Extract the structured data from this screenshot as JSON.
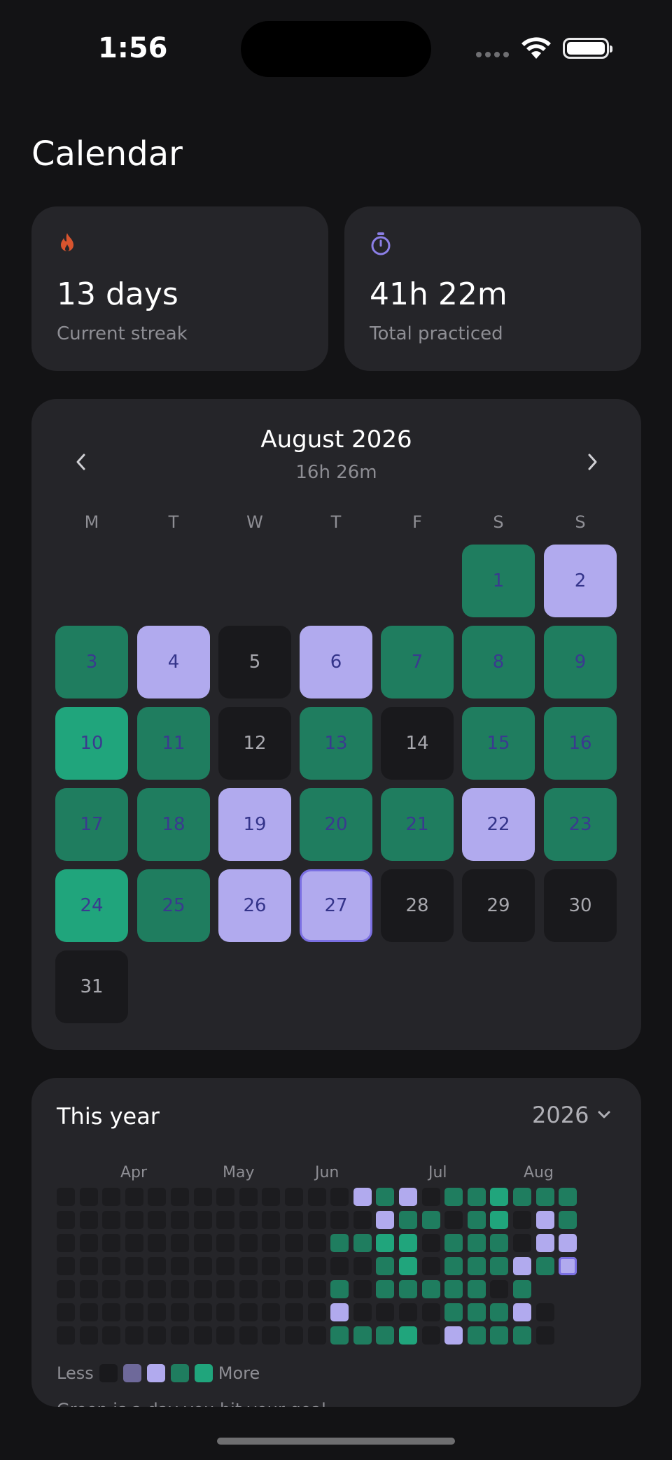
{
  "status": {
    "time": "1:56"
  },
  "page": {
    "title": "Calendar"
  },
  "stats": {
    "streak": {
      "value": "13 days",
      "label": "Current streak",
      "icon": "flame-icon",
      "color": "#d8542e"
    },
    "total": {
      "value": "41h 22m",
      "label": "Total practiced",
      "icon": "stopwatch-icon",
      "color": "#8b7fe6"
    }
  },
  "calendar": {
    "month": "August 2026",
    "total": "16h 26m",
    "weekdays": [
      "M",
      "T",
      "W",
      "T",
      "F",
      "S",
      "S"
    ],
    "days": [
      {
        "day": "1",
        "state": "green"
      },
      {
        "day": "2",
        "state": "purple"
      },
      {
        "day": "3",
        "state": "green"
      },
      {
        "day": "4",
        "state": "purple"
      },
      {
        "day": "5",
        "state": "empty"
      },
      {
        "day": "6",
        "state": "purple"
      },
      {
        "day": "7",
        "state": "green"
      },
      {
        "day": "8",
        "state": "green"
      },
      {
        "day": "9",
        "state": "green"
      },
      {
        "day": "10",
        "state": "bright"
      },
      {
        "day": "11",
        "state": "green"
      },
      {
        "day": "12",
        "state": "empty"
      },
      {
        "day": "13",
        "state": "green"
      },
      {
        "day": "14",
        "state": "empty"
      },
      {
        "day": "15",
        "state": "green"
      },
      {
        "day": "16",
        "state": "green"
      },
      {
        "day": "17",
        "state": "green"
      },
      {
        "day": "18",
        "state": "green"
      },
      {
        "day": "19",
        "state": "purple"
      },
      {
        "day": "20",
        "state": "green"
      },
      {
        "day": "21",
        "state": "green"
      },
      {
        "day": "22",
        "state": "purple"
      },
      {
        "day": "23",
        "state": "green"
      },
      {
        "day": "24",
        "state": "bright"
      },
      {
        "day": "25",
        "state": "green"
      },
      {
        "day": "26",
        "state": "purple"
      },
      {
        "day": "27",
        "state": "today"
      },
      {
        "day": "28",
        "state": "empty"
      },
      {
        "day": "29",
        "state": "empty"
      },
      {
        "day": "30",
        "state": "empty"
      },
      {
        "day": "31",
        "state": "empty"
      }
    ]
  },
  "year": {
    "title": "This year",
    "selected": "2026",
    "months": [
      "Apr",
      "May",
      "Jun",
      "Jul",
      "Aug"
    ],
    "heatmap": [
      "0000000000000P1P0112111",
      "00000000000000P110120P1",
      "000000000000112201110PP",
      "00000000000000120111P1T",
      "000000000000101111101",
      "000000000000P0000111P0",
      "00000000000011120P1110"
    ],
    "legend": {
      "less": "Less",
      "more": "More"
    },
    "footnote": "Green is a day you hit your goal"
  },
  "colors": {
    "background": "#131315",
    "card": "#252529",
    "empty": "#19191c",
    "green": "#1f7d5f",
    "bright_green": "#20a57c",
    "purple": "#b1aaee",
    "accent": "#7b70e2"
  }
}
